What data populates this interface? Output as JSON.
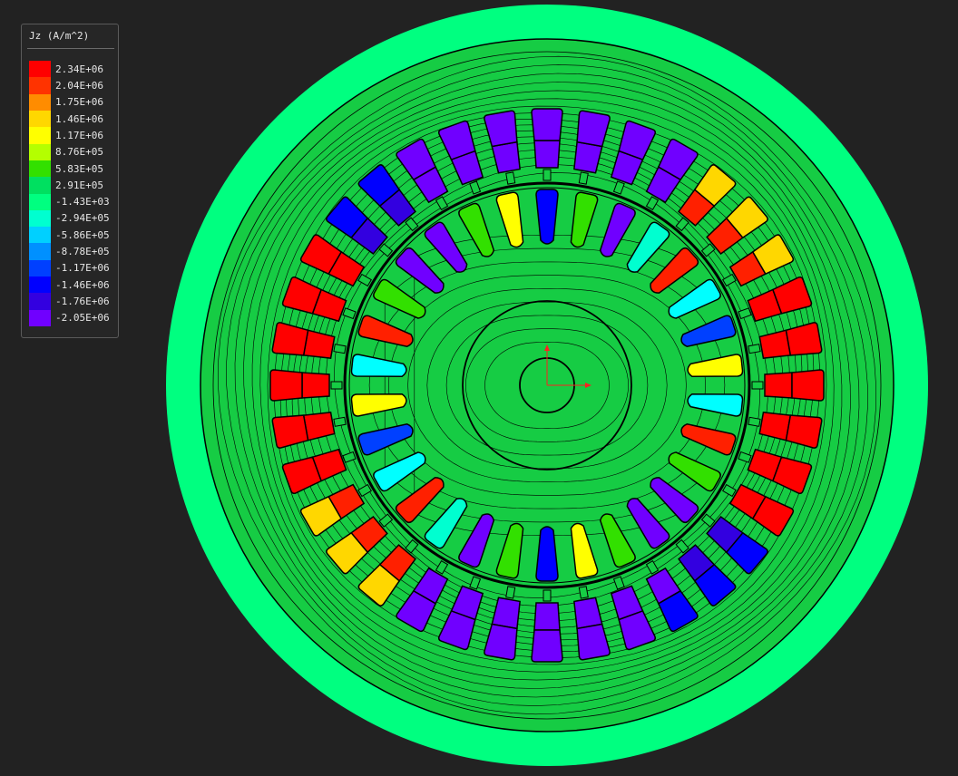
{
  "legend": {
    "title": "Jz (A/m^2)",
    "labels": [
      "2.34E+06",
      "2.04E+06",
      "1.75E+06",
      "1.46E+06",
      "1.17E+06",
      "8.76E+05",
      "5.83E+05",
      "2.91E+05",
      "-1.43E+03",
      "-2.94E+05",
      "-5.86E+05",
      "-8.78E+05",
      "-1.17E+06",
      "-1.46E+06",
      "-1.76E+06",
      "-2.05E+06"
    ],
    "colors": [
      "#ff0000",
      "#ff3300",
      "#ff8c00",
      "#ffd700",
      "#ffff00",
      "#b4ff00",
      "#32e000",
      "#00e060",
      "#00ff80",
      "#00ffd0",
      "#00d0ff",
      "#0090ff",
      "#0040ff",
      "#0000ff",
      "#3300e0",
      "#7000ff"
    ]
  },
  "colors": {
    "background": "#222222",
    "field": "#00ff80",
    "core": "#16cc44",
    "outline": "#000000",
    "axis": "#ff2020"
  },
  "stator_slots": [
    {
      "angle": -90,
      "fill": "#7000ff",
      "split": true
    },
    {
      "angle": -80,
      "fill": "#7000ff",
      "split": true
    },
    {
      "angle": -70,
      "fill": "#7000ff",
      "split": true
    },
    {
      "angle": -60,
      "fill": "#7000ff",
      "split": true
    },
    {
      "angle": -50,
      "fill": "#ffd700",
      "split": true,
      "fill2": "#ff2000"
    },
    {
      "angle": -40,
      "fill": "#ffd700",
      "split": true,
      "fill2": "#ff2000"
    },
    {
      "angle": -30,
      "fill": "#ffd700",
      "split": true,
      "fill2": "#ff2000"
    },
    {
      "angle": -20,
      "fill": "#ff0000",
      "split": true
    },
    {
      "angle": -10,
      "fill": "#ff0000",
      "split": true
    },
    {
      "angle": 0,
      "fill": "#ff0000",
      "split": true
    },
    {
      "angle": 10,
      "fill": "#ff0000",
      "split": true
    },
    {
      "angle": 20,
      "fill": "#ff0000",
      "split": true
    },
    {
      "angle": 30,
      "fill": "#ff0000",
      "split": true
    },
    {
      "angle": 40,
      "fill": "#0000ff",
      "split": true,
      "fill2": "#3300e0"
    },
    {
      "angle": 50,
      "fill": "#0000ff",
      "split": true,
      "fill2": "#3300e0"
    },
    {
      "angle": 60,
      "fill": "#0000ff",
      "split": true,
      "fill2": "#7000ff"
    },
    {
      "angle": 70,
      "fill": "#7000ff",
      "split": true
    },
    {
      "angle": 80,
      "fill": "#7000ff",
      "split": true
    },
    {
      "angle": 90,
      "fill": "#7000ff",
      "split": true
    },
    {
      "angle": 100,
      "fill": "#7000ff",
      "split": true
    },
    {
      "angle": 110,
      "fill": "#7000ff",
      "split": true
    },
    {
      "angle": 120,
      "fill": "#7000ff",
      "split": true
    },
    {
      "angle": 130,
      "fill": "#ffd700",
      "split": true,
      "fill2": "#ff2000"
    },
    {
      "angle": 140,
      "fill": "#ffd700",
      "split": true,
      "fill2": "#ff2000"
    },
    {
      "angle": 150,
      "fill": "#ffd700",
      "split": true,
      "fill2": "#ff2000"
    },
    {
      "angle": 160,
      "fill": "#ff0000",
      "split": true
    },
    {
      "angle": 170,
      "fill": "#ff0000",
      "split": true
    },
    {
      "angle": 180,
      "fill": "#ff0000",
      "split": true
    },
    {
      "angle": 190,
      "fill": "#ff0000",
      "split": true
    },
    {
      "angle": 200,
      "fill": "#ff0000",
      "split": true
    },
    {
      "angle": 210,
      "fill": "#ff0000",
      "split": true
    },
    {
      "angle": 220,
      "fill": "#0000ff",
      "split": true,
      "fill2": "#3300e0"
    },
    {
      "angle": 230,
      "fill": "#0000ff",
      "split": true,
      "fill2": "#3300e0"
    },
    {
      "angle": 240,
      "fill": "#7000ff",
      "split": true
    },
    {
      "angle": 250,
      "fill": "#7000ff",
      "split": true
    },
    {
      "angle": 260,
      "fill": "#7000ff",
      "split": true
    }
  ],
  "rotor_slots": [
    {
      "angle": -90,
      "fill": "#0000ff"
    },
    {
      "angle": -78,
      "fill": "#32e000"
    },
    {
      "angle": -66,
      "fill": "#7000ff"
    },
    {
      "angle": -54,
      "fill": "#00ffd0"
    },
    {
      "angle": -42,
      "fill": "#ff2000"
    },
    {
      "angle": -30,
      "fill": "#00ffff"
    },
    {
      "angle": -18,
      "fill": "#0040ff"
    },
    {
      "angle": -6,
      "fill": "#ffff00"
    },
    {
      "angle": 6,
      "fill": "#00ffff"
    },
    {
      "angle": 18,
      "fill": "#ff2000"
    },
    {
      "angle": 30,
      "fill": "#32e000"
    },
    {
      "angle": 42,
      "fill": "#7000ff"
    },
    {
      "angle": 54,
      "fill": "#7000ff"
    },
    {
      "angle": 66,
      "fill": "#32e000"
    },
    {
      "angle": 78,
      "fill": "#ffff00"
    },
    {
      "angle": 90,
      "fill": "#0000ff"
    },
    {
      "angle": 102,
      "fill": "#32e000"
    },
    {
      "angle": 114,
      "fill": "#7000ff"
    },
    {
      "angle": 126,
      "fill": "#00ffd0"
    },
    {
      "angle": 138,
      "fill": "#ff2000"
    },
    {
      "angle": 150,
      "fill": "#00ffff"
    },
    {
      "angle": 162,
      "fill": "#0040ff"
    },
    {
      "angle": 174,
      "fill": "#ffff00"
    },
    {
      "angle": 186,
      "fill": "#00ffff"
    },
    {
      "angle": 198,
      "fill": "#ff2000"
    },
    {
      "angle": 210,
      "fill": "#32e000"
    },
    {
      "angle": 222,
      "fill": "#7000ff"
    },
    {
      "angle": 234,
      "fill": "#7000ff"
    },
    {
      "angle": 246,
      "fill": "#32e000"
    },
    {
      "angle": 258,
      "fill": "#ffff00"
    }
  ]
}
